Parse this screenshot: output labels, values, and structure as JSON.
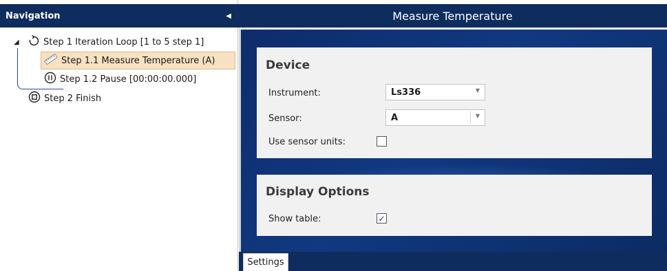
{
  "navigation": {
    "title": "Navigation",
    "collapse_glyph": "◀",
    "expander_glyph": "◢",
    "items": [
      {
        "label": "Step 1 Iteration Loop [1 to 5 step 1]",
        "icon": "loop-icon"
      },
      {
        "label": "Step 1.1 Measure Temperature (A)",
        "icon": "ruler-icon",
        "selected": true
      },
      {
        "label": "Step 1.2 Pause [00:00:00.000]",
        "icon": "pause-icon"
      },
      {
        "label": "Step 2 Finish",
        "icon": "stop-icon"
      }
    ]
  },
  "content": {
    "title": "Measure Temperature",
    "device": {
      "title": "Device",
      "instrument_label": "Instrument:",
      "instrument_value": "Ls336",
      "sensor_label": "Sensor:",
      "sensor_value": "A",
      "use_sensor_units_label": "Use sensor units:",
      "use_sensor_units_checked": false
    },
    "display_options": {
      "title": "Display Options",
      "show_table_label": "Show table:",
      "show_table_checked": true,
      "check_glyph": "✓"
    },
    "tabs": [
      {
        "label": "Settings",
        "active": true
      }
    ]
  },
  "colors": {
    "header_bg": "#0e2c5e",
    "content_bg": "#103980",
    "selected_bg": "#f7e1c2",
    "panel_bg": "#f1f1f1",
    "connector": "#2b44a0"
  }
}
